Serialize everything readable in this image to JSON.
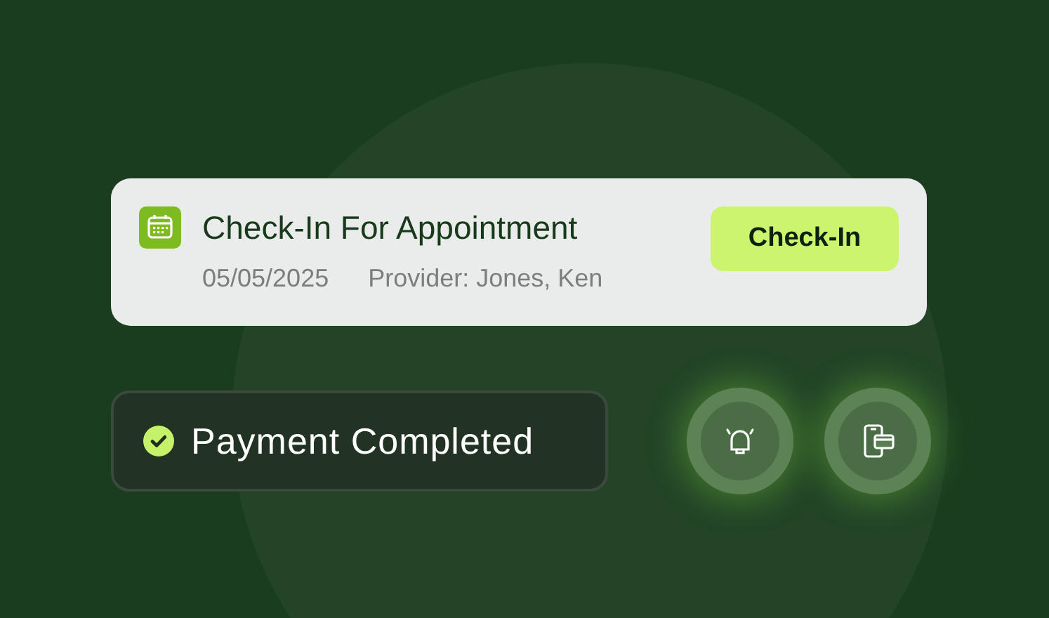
{
  "appointment_card": {
    "title": "Check-In For Appointment",
    "date": "05/05/2025",
    "provider": "Provider: Jones, Ken",
    "button": "Check-In"
  },
  "status_pill": {
    "text": "Payment Completed"
  },
  "action_buttons": [
    {
      "kind": "bell"
    },
    {
      "kind": "phone-card"
    }
  ]
}
